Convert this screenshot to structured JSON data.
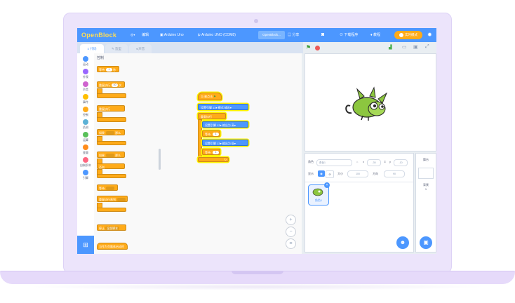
{
  "app": {
    "logo": "OpenBlock",
    "menu": {
      "language_label": "",
      "edit_label": "编辑",
      "board_label": "Arduino Uno",
      "device_label": "Arduino UNO (COM8)",
      "project_title": "OpenBlock...",
      "share_label": "分享",
      "upload_label": "下载程序",
      "tutorials_label": "教程",
      "mode_label": "实时模式"
    },
    "tabs": [
      "代码",
      "造型",
      "声音"
    ],
    "categories": [
      {
        "label": "运动",
        "color": "#4c97ff"
      },
      {
        "label": "外观",
        "color": "#9966ff"
      },
      {
        "label": "声音",
        "color": "#cf63cf"
      },
      {
        "label": "事件",
        "color": "#ffbf00"
      },
      {
        "label": "控制",
        "color": "#ffab19"
      },
      {
        "label": "侦测",
        "color": "#5cb1d6"
      },
      {
        "label": "运算",
        "color": "#59c059"
      },
      {
        "label": "变量",
        "color": "#ff8c1a"
      },
      {
        "label": "自制积木",
        "color": "#ff6680"
      },
      {
        "label": "引脚",
        "color": "#4c97ff"
      }
    ],
    "palette": {
      "section_title": "控制",
      "blocks": [
        {
          "text": "等待",
          "value": "1",
          "suffix": "秒"
        },
        {
          "text": "重复执行",
          "value": "10",
          "suffix": "次"
        },
        {
          "text": "重复执行"
        },
        {
          "text": "如果",
          "suffix": "那么"
        },
        {
          "text": "如果",
          "suffix": "那么"
        },
        {
          "text": "否则"
        },
        {
          "text": "等待"
        },
        {
          "text": "重复执行直到"
        },
        {
          "text": "停止",
          "value": "全部脚本"
        },
        {
          "text": "当作为克隆体启动时"
        }
      ]
    },
    "script": {
      "hat": "当 被点击",
      "set_mode": {
        "text": "设置引脚",
        "pin": "13",
        "mid": "模式",
        "value": "输出"
      },
      "forever": "重复执行",
      "set_high": {
        "text": "设置引脚",
        "pin": "13",
        "mid": "输出为",
        "value": "高"
      },
      "wait1": {
        "text": "等待",
        "value": "1",
        "suffix": "秒"
      },
      "set_low": {
        "text": "设置引脚",
        "pin": "13",
        "mid": "输出为",
        "value": "低"
      },
      "wait2": {
        "text": "等待",
        "value": "1",
        "suffix": "秒"
      }
    },
    "zoom": {
      "in": "+",
      "out": "−",
      "reset": "="
    },
    "sprite_info": {
      "sprite_label": "角色",
      "sprite_name": "角色1",
      "x_label": "x",
      "x_value": "-35",
      "y_label": "y",
      "y_value": "-10",
      "show_label": "显示",
      "size_label": "大小",
      "size_value": "100",
      "direction_label": "方向",
      "direction_value": "90"
    },
    "sprite_thumb_label": "角色1",
    "stage_panel": {
      "title": "舞台",
      "backdrops_label": "背景",
      "backdrops_count": "1"
    },
    "colors": {
      "accent": "#4c97ff",
      "control": "#ffab19",
      "laptop": "#ece4fb"
    }
  }
}
